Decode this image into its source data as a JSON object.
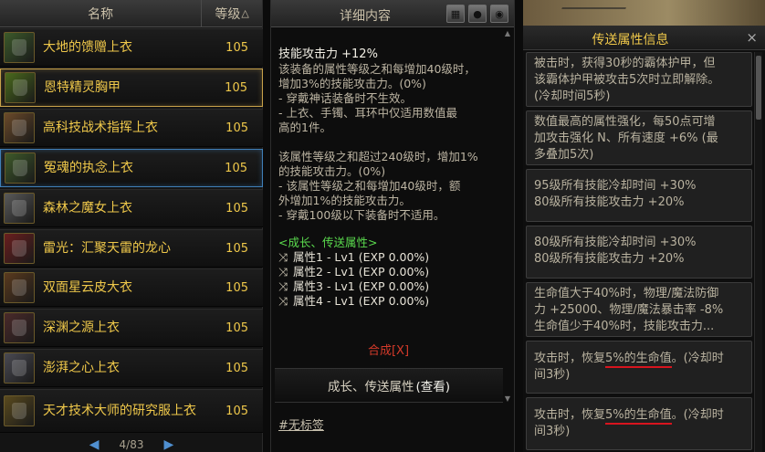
{
  "list": {
    "header_name": "名称",
    "header_level": "等级",
    "header_level_arrow": "△",
    "items": [
      {
        "name": "大地的馈赠上衣",
        "level": "105",
        "icon": "armor-earth-icon",
        "color": "#3c5a2a"
      },
      {
        "name": "恩特精灵胸甲",
        "level": "105",
        "icon": "armor-ent-icon",
        "color": "#4a6a1c"
      },
      {
        "name": "高科技战术指挥上衣",
        "level": "105",
        "icon": "armor-tech-icon",
        "color": "#6b4a2a"
      },
      {
        "name": "冤魂的执念上衣",
        "level": "105",
        "icon": "armor-soul-icon",
        "color": "#3e5a2a"
      },
      {
        "name": "森林之魔女上衣",
        "level": "105",
        "icon": "armor-witch-icon",
        "color": "#5a5a5a"
      },
      {
        "name": "雷光：汇聚天雷的龙心",
        "level": "105",
        "icon": "armor-thunder-icon",
        "color": "#6a1e1e"
      },
      {
        "name": "双面星云皮大衣",
        "level": "105",
        "icon": "armor-nebula-icon",
        "color": "#5a3a1e"
      },
      {
        "name": "深渊之源上衣",
        "level": "105",
        "icon": "armor-abyss-icon",
        "color": "#4a2a2a"
      },
      {
        "name": "澎湃之心上衣",
        "level": "105",
        "icon": "armor-heart-icon",
        "color": "#4a4a52"
      },
      {
        "name": "天才技术大师的研究服上衣",
        "level": "105",
        "icon": "armor-genius-icon",
        "color": "#5a4a1e"
      }
    ],
    "pager": "4/83"
  },
  "detail": {
    "header": "详细内容",
    "lines": [
      {
        "text": "技能攻击力 +12%",
        "kind": "title"
      },
      {
        "text": "该装备的属性等级之和每增加40级时，",
        "kind": "body"
      },
      {
        "text": "增加3%的技能攻击力。(0%)",
        "kind": "body"
      },
      {
        "text": "- 穿戴神话装备时不生效。",
        "kind": "body"
      },
      {
        "text": "- 上衣、手镯、耳环中仅适用数值最",
        "kind": "body"
      },
      {
        "text": "高的1件。",
        "kind": "body"
      },
      {
        "text": "",
        "kind": "gap"
      },
      {
        "text": "该属性等级之和超过240级时，增加1%",
        "kind": "body"
      },
      {
        "text": "的技能攻击力。(0%)",
        "kind": "body"
      },
      {
        "text": "- 该属性等级之和每增加40级时，额",
        "kind": "body"
      },
      {
        "text": "外增加1%的技能攻击力。",
        "kind": "body"
      },
      {
        "text": "- 穿戴100级以下装备时不适用。",
        "kind": "body"
      }
    ],
    "growth_header": "<成长、传送属性>",
    "attrs": [
      "属性1 - Lv1 (EXP 0.00%)",
      "属性2 - Lv1 (EXP 0.00%)",
      "属性3 - Lv1 (EXP 0.00%)",
      "属性4 - Lv1 (EXP 0.00%)"
    ],
    "compose": "合成[X]",
    "view_prefix": "成长、传送属性",
    "view_link": "(查看)",
    "tag": "#无标签"
  },
  "transfer": {
    "title": "传送属性信息",
    "close": "×",
    "cards": [
      {
        "lines": [
          "被击时，获得30秒的霸体护甲，但",
          "该霸体护甲被攻击5次时立即解除。",
          "(冷却时间5秒)"
        ]
      },
      {
        "lines": [
          "数值最高的属性强化，每50点可增",
          "加攻击强化 N、所有速度 +6% (最",
          "多叠加5次)"
        ]
      },
      {
        "lines": [
          "95级所有技能冷却时间 +30%",
          "80级所有技能攻击力 +20%"
        ]
      },
      {
        "lines": [
          "80级所有技能冷却时间 +30%",
          "80级所有技能攻击力 +20%"
        ]
      },
      {
        "lines": [
          "生命值大于40%时，物理/魔法防御",
          "力 +25000、物理/魔法暴击率 -8%",
          "生命值少于40%时，技能攻击力..."
        ]
      },
      {
        "lines": [
          "攻击时，恢复5%的生命值。(冷却时",
          "间3秒)"
        ]
      },
      {
        "lines": [
          "攻击时，恢复5%的生命值。(冷却时",
          "间3秒)"
        ]
      }
    ]
  }
}
